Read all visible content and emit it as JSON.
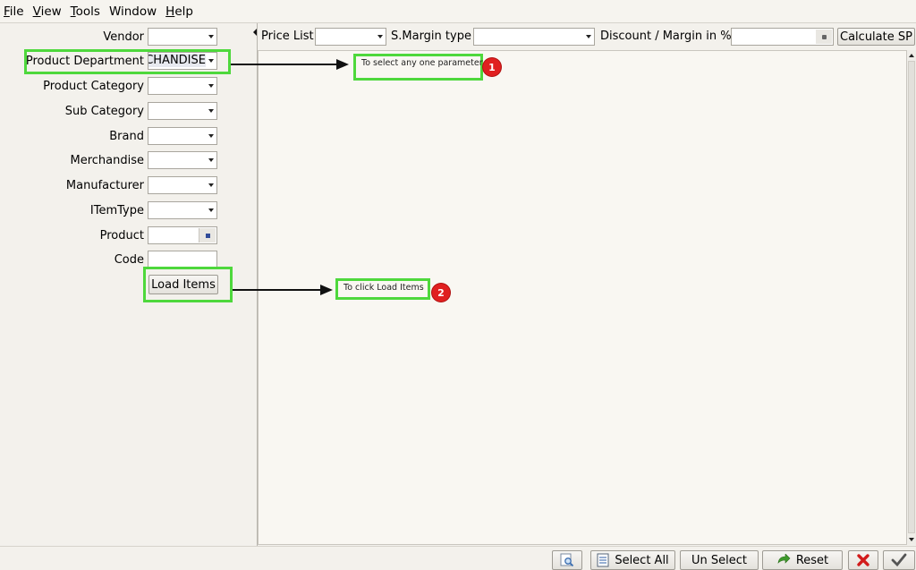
{
  "menu": [
    {
      "label": "File",
      "mnemonic": "F",
      "rest": "ile"
    },
    {
      "label": "View",
      "mnemonic": "V",
      "rest": "iew"
    },
    {
      "label": "Tools",
      "mnemonic": "T",
      "rest": "ools"
    },
    {
      "label": "Window",
      "mnemonic": "",
      "rest": "Window"
    },
    {
      "label": "Help",
      "mnemonic": "H",
      "rest": "elp"
    }
  ],
  "filters": {
    "vendor": {
      "label": "Vendor",
      "value": ""
    },
    "product_department": {
      "label": "Product Department",
      "value": "MERCHANDISE"
    },
    "product_category": {
      "label": "Product Category",
      "value": ""
    },
    "sub_category": {
      "label": "Sub Category",
      "value": ""
    },
    "brand": {
      "label": "Brand",
      "value": ""
    },
    "merchandise": {
      "label": "Merchandise",
      "value": ""
    },
    "manufacturer": {
      "label": "Manufacturer",
      "value": ""
    },
    "item_type": {
      "label": "ITemType",
      "value": ""
    },
    "product": {
      "label": "Product",
      "value": ""
    },
    "code": {
      "label": "Code",
      "value": ""
    },
    "load_items_label": "Load Items"
  },
  "toolbar": {
    "price_list_label": "Price List",
    "smargin_type_label": "S.Margin type",
    "discount_margin_label": "Discount / Margin in %",
    "calculate_sp_label": "Calculate SP"
  },
  "bottom": {
    "select_all_label": "Select All",
    "unselect_label": "Un Select",
    "reset_label": "Reset"
  },
  "annotations": {
    "note1": "To select any one parameter",
    "note2": "To click Load Items",
    "badge1": "1",
    "badge2": "2"
  },
  "colors": {
    "highlight": "#4ed83c",
    "badge": "#e02020"
  }
}
